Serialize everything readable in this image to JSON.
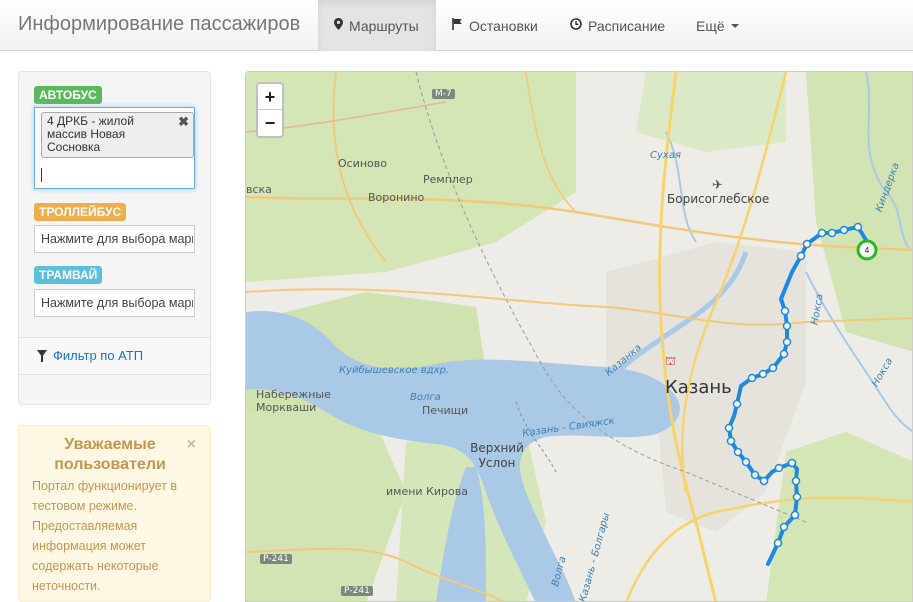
{
  "app": {
    "title": "Информирование пассажиров"
  },
  "nav": {
    "routes": "Маршруты",
    "stops": "Остановки",
    "schedule": "Расписание",
    "more": "Ещё"
  },
  "sidebar": {
    "bus_label": "АВТОБУС",
    "bus_selected": "4 ДРКБ - жилой массив Новая Сосновка",
    "trolley_label": "ТРОЛЛЕЙБУС",
    "trolley_placeholder": "Нажмите для выбора маршрута",
    "tram_label": "ТРАМВАЙ",
    "tram_placeholder": "Нажмите для выбора маршрута",
    "filter": "Фильтр по АТП"
  },
  "alert": {
    "title": "Уважаемые пользователи",
    "close": "×",
    "body": "Портал функционирует в тестовом режиме. Предоставляемая информация может содержать некоторые неточности."
  },
  "map": {
    "zoom_in": "+",
    "zoom_out": "−",
    "route_marker": "4",
    "route_color": "#1e88e5",
    "marker_color": "#22bb22",
    "places": {
      "kazan": "Казань",
      "borisoglebskoe": "Борисоглебское",
      "osinovo": "Осиново",
      "voronino": "Воронино",
      "rempler": "Ремплер",
      "naberezhnye_morkvashi": "Набережные Моркваши",
      "pechishchi": "Печищи",
      "verkhny_uslon": "Верхний Услон",
      "imeni_kirova": "имени Кирова",
      "kuibyshev_res": "Куйбышевское вдхр.",
      "volga1": "Волга",
      "volga2": "Волга",
      "sukhaya": "Сухая",
      "kinderka": "Киндерка",
      "noksa1": "Нокса",
      "noksa2": "Нокса",
      "kazanka": "Казанка",
      "kazan_sviyazhsk": "Казань - Свияжск",
      "kazan_bolgary": "Казань - Болгары",
      "vska": "вска",
      "m7": "М-7",
      "r241a": "Р-241",
      "r241b": "Р-241"
    }
  }
}
